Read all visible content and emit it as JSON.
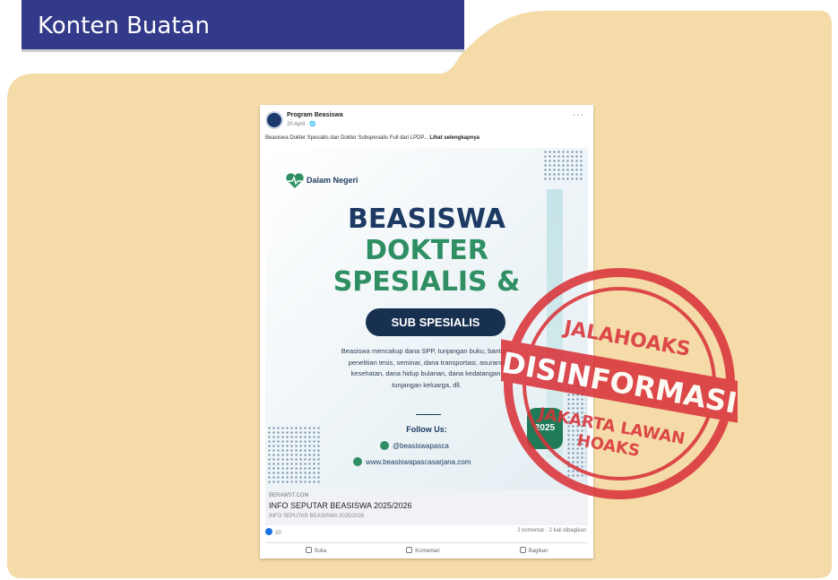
{
  "title": "Konten Buatan",
  "colors": {
    "folder": "#f4dba8",
    "title_tab": "#333a8a",
    "stamp": "#d9343a",
    "poster_navy": "#1c3a63",
    "poster_green": "#2f8f63"
  },
  "post": {
    "page_name": "Program Beasiswa",
    "date": "20 April · 🌐",
    "caption": "Beasiswa Dokter Spesialis dan Dokter Subspesialis Full dari LPDP...",
    "see_more": "Lihat selengkapnya",
    "poster": {
      "region_label": "Dalam Negeri",
      "headline_1": "BEASISWA",
      "headline_2": "DOKTER",
      "headline_3": "SPESIALIS &",
      "sub_pill": "SUB SPESIALIS",
      "description": "Beasiswa mencakup dana SPP, tunjangan buku, bantuan penelitian tesis, seminar, dana transportasi, asuransi kesehatan, dana hidup bulanan, dana kedatangan, tunjangan keluarga, dll.",
      "follow_label": "Follow Us:",
      "instagram": "@beasiswapasca",
      "website": "www.beasiswapascasarjana.com",
      "badge_year": "2025"
    },
    "link": {
      "domain": "BERAWST.COM",
      "title": "INFO SEPUTAR BEASISWA 2025/2026",
      "subtitle": "INFO SEPUTAR BEASISWA 2025/2026"
    },
    "stats": {
      "likes": "20",
      "comments_shares": "2 komentar · 2 kali dibagikan"
    },
    "actions": {
      "like": "Suka",
      "comment": "Komentari",
      "share": "Bagikan"
    }
  },
  "stamp": {
    "top_text": "JALAHOAKS",
    "main_text": "DISINFORMASI",
    "bottom_line_1": "JAKARTA LAWAN",
    "bottom_line_2": "HOAKS"
  }
}
